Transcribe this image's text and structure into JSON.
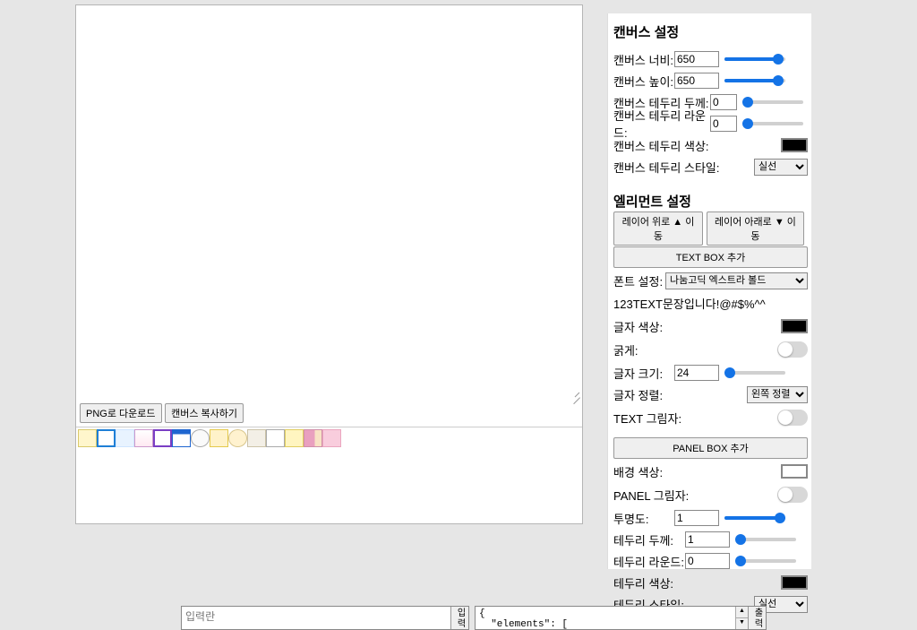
{
  "canvasSection": {
    "title": "캔버스 설정",
    "widthLabel": "캔버스 너비:",
    "widthValue": "650",
    "heightLabel": "캔버스 높이:",
    "heightValue": "650",
    "borderWidthLabel": "캔버스 테두리 두께:",
    "borderWidthValue": "0",
    "borderRadiusLabel": "캔버스 테두리 라운드:",
    "borderRadiusValue": "0",
    "borderColorLabel": "캔버스 테두리 색상:",
    "borderStyleLabel": "캔버스 테두리 스타일:",
    "borderStyleValue": "실선"
  },
  "elementSection": {
    "title": "엘리먼트 설정",
    "layerUp": "레이어 위로 ▲ 이동",
    "layerDown": "레이어 아래로 ▼ 이동",
    "addTextBox": "TEXT BOX 추가",
    "fontLabel": "폰트 설정:",
    "fontValue": "나눔고딕 엑스트라 볼드",
    "sampleText": "123TEXT문장입니다!@#$%^^",
    "textColorLabel": "글자 색상:",
    "boldLabel": "굵게:",
    "fontSizeLabel": "글자 크기:",
    "fontSizeValue": "24",
    "alignLabel": "글자 정렬:",
    "alignValue": "왼쪽 정렬",
    "textShadowLabel": "TEXT 그림자:",
    "addPanelBox": "PANEL BOX 추가",
    "bgColorLabel": "배경 색상:",
    "panelShadowLabel": "PANEL 그림자:",
    "opacityLabel": "투명도:",
    "opacityValue": "1",
    "pBorderWidthLabel": "테두리 두께:",
    "pBorderWidthValue": "1",
    "pBorderRadiusLabel": "테두리 라운드:",
    "pBorderRadiusValue": "0",
    "pBorderColorLabel": "테두리 색상:",
    "pBorderStyleLabel": "테두리 스타일:",
    "pBorderStyleValue": "실선"
  },
  "buttons": {
    "downloadPng": "PNG로 다운로드",
    "copyCanvas": "캔버스 복사하기"
  },
  "bottom": {
    "inputPlaceholder": "입력란",
    "inputBtn": "입력",
    "outputText": "{\n  \"elements\": [",
    "outputBtn": "출력"
  }
}
